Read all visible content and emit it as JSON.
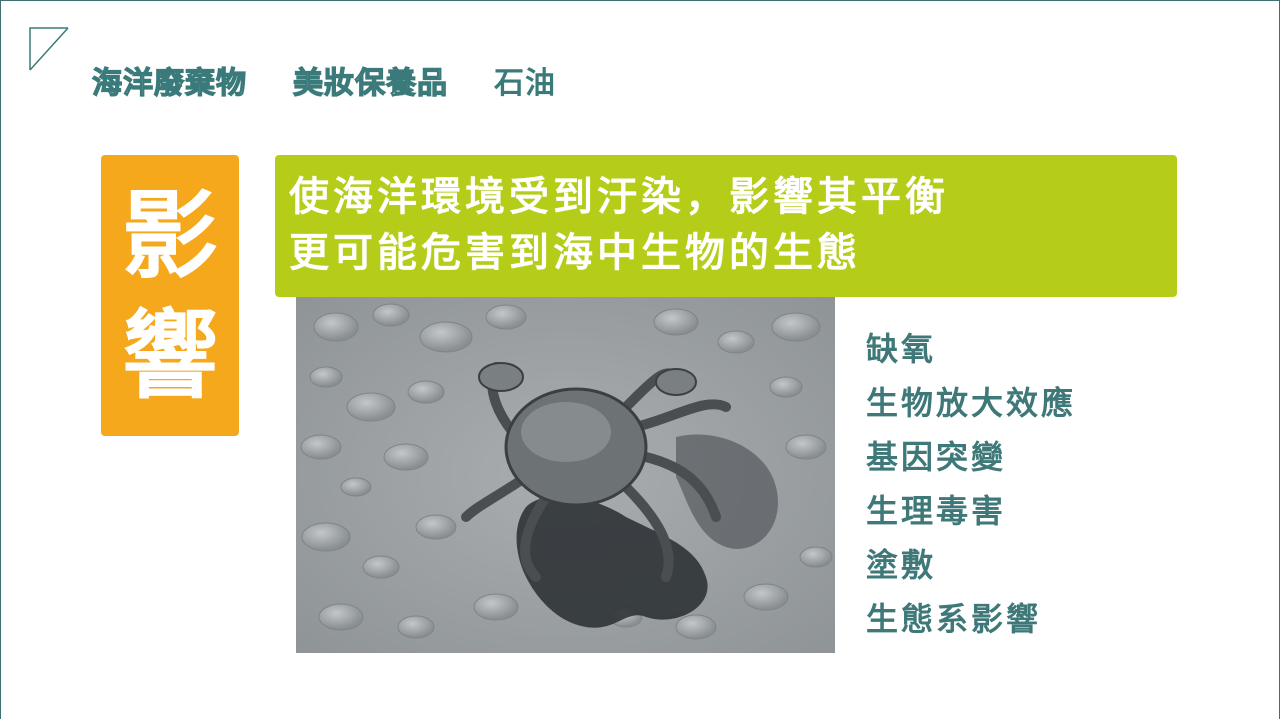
{
  "slide": {
    "nav": [
      {
        "label": "海洋廢棄物",
        "active": false
      },
      {
        "label": "美妝保養品",
        "active": false
      },
      {
        "label": "石油",
        "active": true
      }
    ],
    "impact_title": [
      "影",
      "響"
    ],
    "headline_lines": [
      "使海洋環境受到汙染，影響其平衡",
      "更可能危害到海中生物的生態"
    ],
    "effects": [
      "缺氧",
      "生物放大效應",
      "基因突變",
      "生理毒害",
      "塗敷",
      "生態系影響"
    ]
  },
  "colors": {
    "teal": "#3a7a7a",
    "orange": "#f5a81c",
    "lime": "#b5cc18",
    "white": "#ffffff"
  },
  "icons": {
    "corner": "corner-triangle-icon"
  }
}
